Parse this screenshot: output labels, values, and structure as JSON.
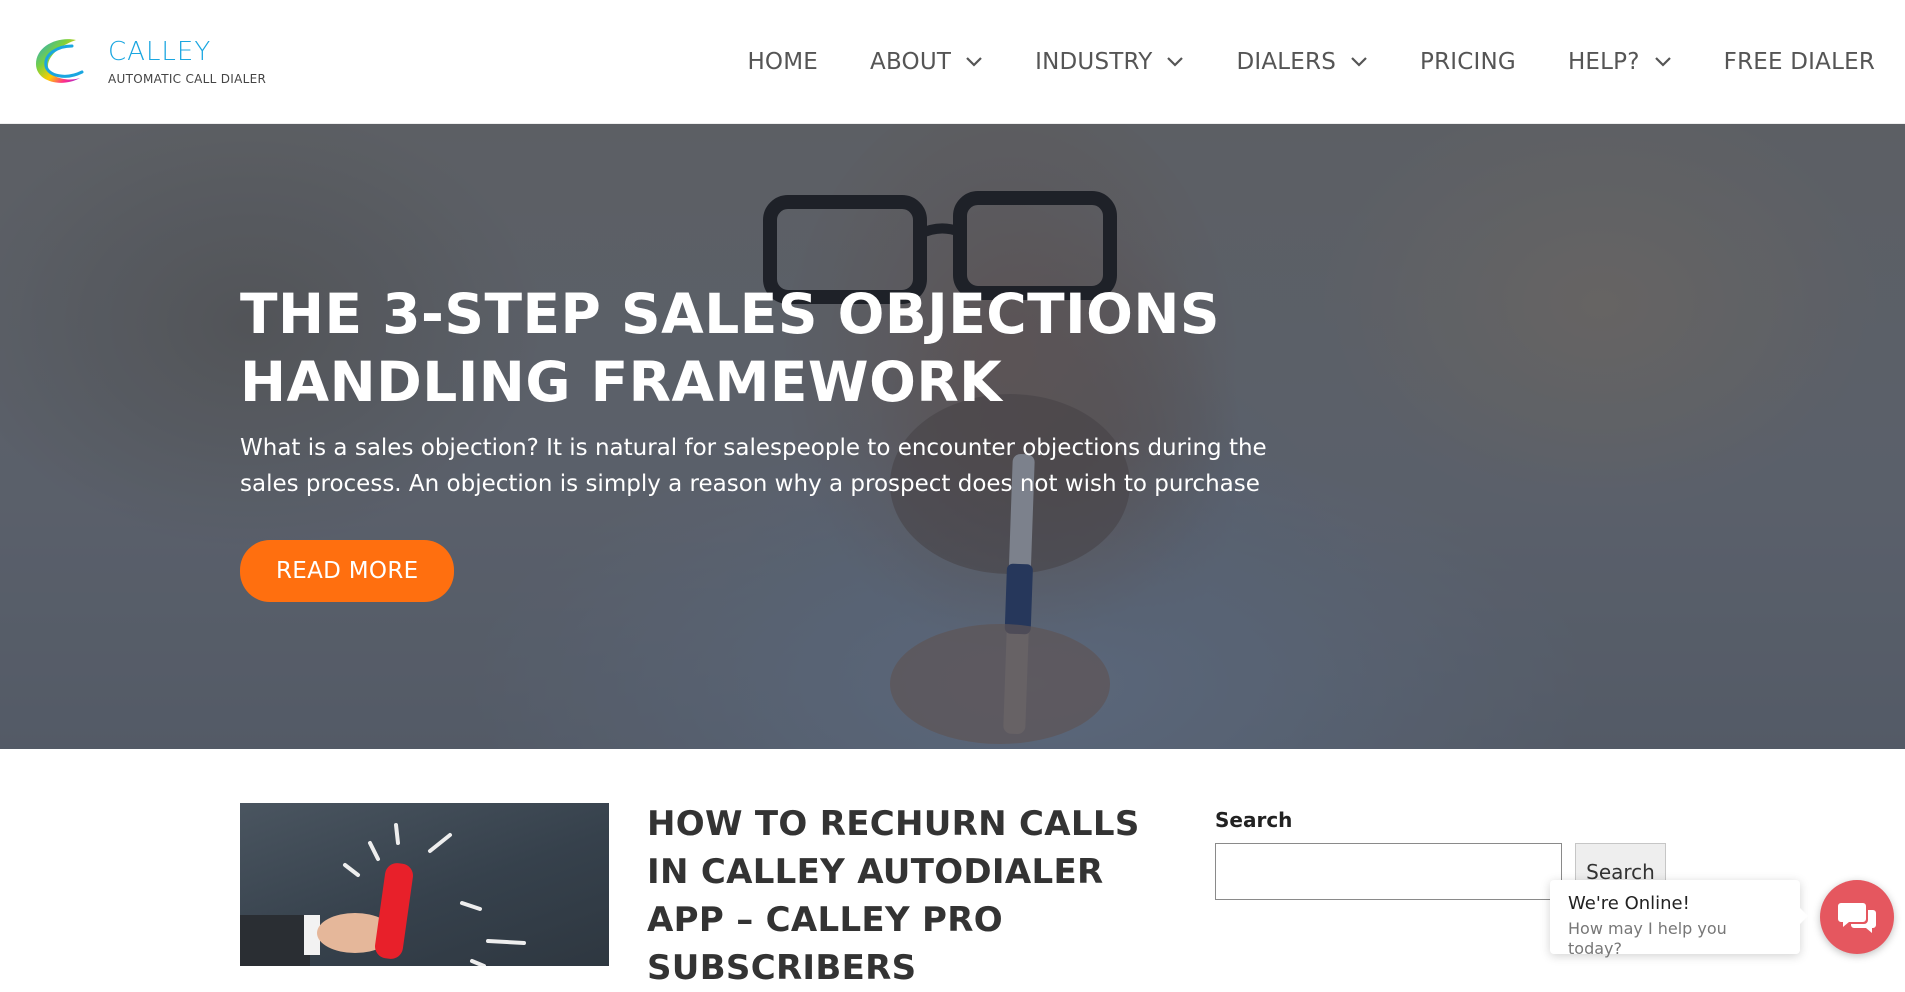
{
  "brand": {
    "name": "CALLEY",
    "tagline": "AUTOMATIC CALL DIALER",
    "accent": "#1aa6e0"
  },
  "nav": {
    "items": [
      {
        "label": "HOME",
        "has_dropdown": false
      },
      {
        "label": "ABOUT",
        "has_dropdown": true
      },
      {
        "label": "INDUSTRY",
        "has_dropdown": true
      },
      {
        "label": "DIALERS",
        "has_dropdown": true
      },
      {
        "label": "PRICING",
        "has_dropdown": false
      },
      {
        "label": "HELP?",
        "has_dropdown": true
      },
      {
        "label": "FREE DIALER",
        "has_dropdown": false
      }
    ],
    "dropdown_icon": "chevron-down-icon"
  },
  "hero": {
    "title": "THE 3-STEP SALES OBJECTIONS HANDLING FRAMEWORK",
    "excerpt": "What is a sales objection? It is natural for salespeople to encounter objections during the sales process. An objection is simply a reason why a prospect does not wish to purchase",
    "cta_label": "READ MORE",
    "cta_color": "#ff6f0f"
  },
  "posts": [
    {
      "title": "HOW TO RECHURN CALLS IN CALLEY AUTODIALER APP – CALLEY PRO SUBSCRIBERS",
      "thumbnail_icon": "ringing-phone-receiver-icon"
    }
  ],
  "sidebar": {
    "search_label": "Search",
    "search_value": "",
    "search_button_label": "Search"
  },
  "chat": {
    "status": "We're Online!",
    "prompt": "How may I help you today?",
    "icon": "chat-bubbles-icon",
    "color": "#e5575f"
  }
}
